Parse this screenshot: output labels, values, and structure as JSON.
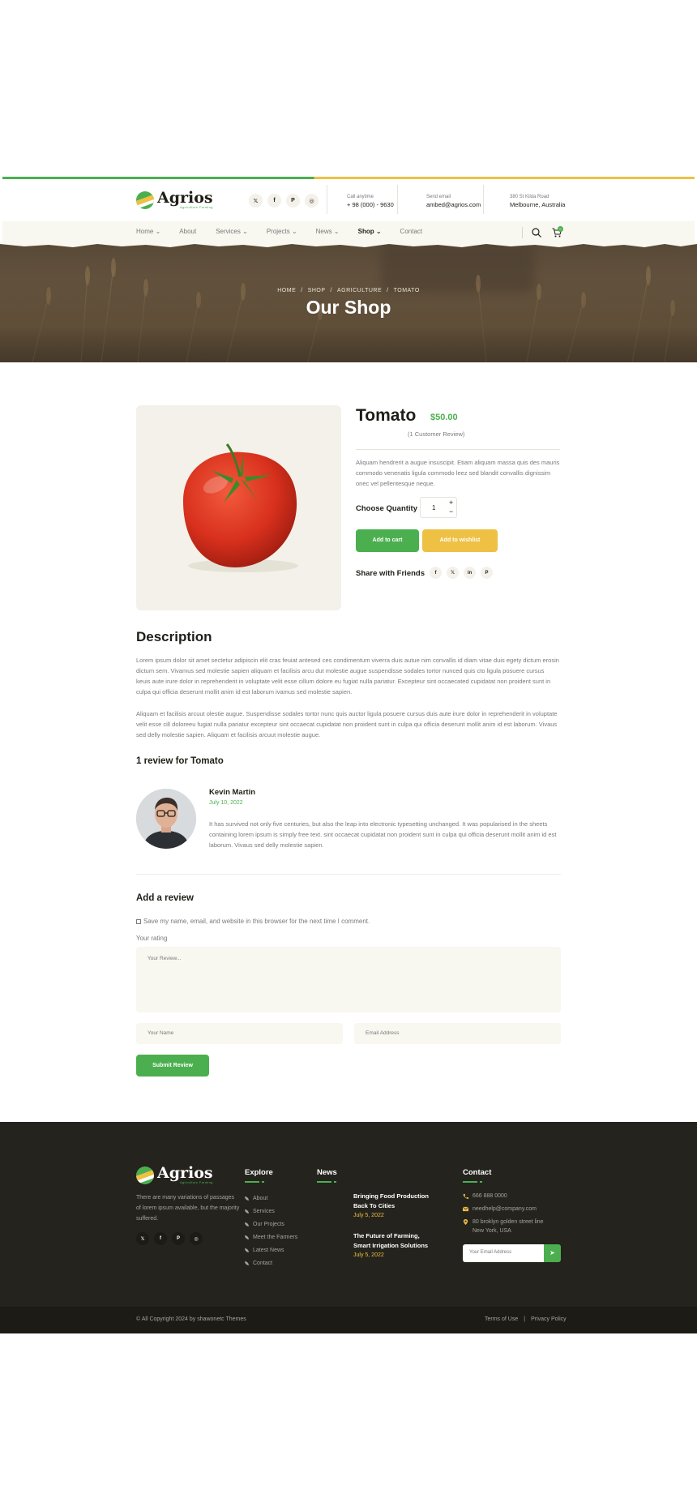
{
  "header": {
    "logo_text": "Agrios",
    "logo_sub": "Agriculture Farming",
    "social": [
      "twitter-icon",
      "facebook-icon",
      "pinterest-icon",
      "instagram-icon"
    ],
    "call_title": "Call anytime",
    "call_value": "+ 98 (000) - 9630",
    "email_title": "Send email",
    "email_value": "ambed@agrios.com",
    "address_title": "380 St Kilda Road",
    "address_value": "Melbourne, Australia"
  },
  "nav": {
    "items": [
      "Home",
      "About",
      "Services",
      "Projects",
      "News",
      "Shop",
      "Contact"
    ],
    "cart_count": "0"
  },
  "hero": {
    "breadcrumb": [
      "HOME",
      "SHOP",
      "AGRICULTURE",
      "TOMATO"
    ],
    "title": "Our Shop"
  },
  "product": {
    "name": "Tomato",
    "price": "$50.00",
    "reviews": "(1 Customer Review)",
    "description": "Aliquam hendrerit a augue insuscipit. Etiam aliquam massa quis des mauris commodo venenatis ligula commodo leez sed blandit convallis dignissim onec vel pellentesque neque.",
    "quantity_label": "Choose Quantity",
    "quantity": "1",
    "plus": "+",
    "minus": "−",
    "add_to_cart": "Add to cart",
    "add_to_wishlist": "Add to wishlist",
    "share_label": "Share with Friends"
  },
  "description": {
    "title": "Description",
    "p1": "Lorem ipsum dolor sit amet sectetur adipiscin elit cras feuiat antesed ces condimentum viverra duis autue nim convallis id diam vitae duis egety dictum erosin dictum sem. Vivamus sed molestie sapien aliquam et facilisis arcu dut molestie augue suspendisse sodales tortor nunced quis cto ligula posuere cursus keuis aute irure dolor in reprehenderit in voluptate velit esse cillum dolore eu fugiat nulla pariatur. Excepteur sint occaecated cupidatat non proident sunt in culpa qui officia deserunt mollit anim id est laborum ivamus sed molestie sapien.",
    "p2": "Aliquam et facilisis arcuut olestie augue. Suspendisse sodales tortor nunc quis auctor ligula posuere cursus duis aute irure dolor in reprehenderit in voluptate velit esse cill doloreeu fugiat nulla pariatur excepteur sint occaecat cupidatat non proident sunt in culpa qui officia deserunt mollit anim id est laborum. Vivaus sed delly molestie sapien. Aliquam et facilisis arcuut molestie augue."
  },
  "reviews": {
    "title": "1 review for Tomato",
    "name": "Kevin Martin",
    "date": "July 10, 2022",
    "text": "It has survived not only five centuries, but also the leap into electronic typesetting unchanged. It was popularised in the sheets containing lorem ipsum is simply free text. sint occaecat cupidatat non proident sunt in culpa qui officia deserunt mollit anim id est laborum. Vivaus sed delly molestie sapien."
  },
  "form": {
    "title": "Add a review",
    "save_label": "Save my name, email, and website in this browser for the next time I comment.",
    "rating_label": "Your rating",
    "review_placeholder": "Your Review...",
    "name_placeholder": "Your Name",
    "email_placeholder": "Email Address",
    "submit": "Submit Review"
  },
  "footer": {
    "about": "There are many variations of passages of lorem ipsum available, but the majority suffered.",
    "explore_title": "Explore",
    "explore": [
      "About",
      "Services",
      "Our Projects",
      "Meet the Farmers",
      "Latest News",
      "Contact"
    ],
    "news_title": "News",
    "news": [
      {
        "title": "Bringing Food Production Back To Cities",
        "date": "July 5, 2022"
      },
      {
        "title": "The Future of Farming, Smart Irrigation Solutions",
        "date": "July 5, 2022"
      }
    ],
    "contact_title": "Contact",
    "phone": "666 888 0000",
    "email": "needhelp@company.com",
    "address": "80 broklyn golden street line New York, USA",
    "email_placeholder": "Your Email Address",
    "copyright": "© All Copyright 2024 by shawonetc Themes",
    "terms": "Terms of Use",
    "privacy": "Privacy Policy"
  },
  "colors": {
    "green": "#4baf4f",
    "yellow": "#eec044",
    "dark": "#24231d"
  }
}
